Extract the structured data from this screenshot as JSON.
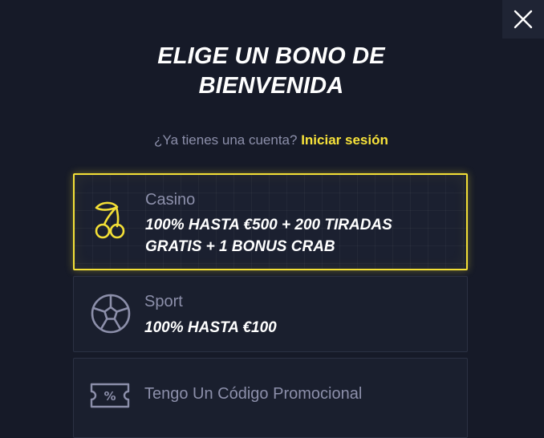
{
  "dialog": {
    "close_icon": "close-icon",
    "title_line1": "ELIGE UN BONO DE",
    "title_line2": "BIENVENIDA",
    "login_prompt": "¿Ya tienes una cuenta?",
    "login_link": "Iniciar sesión"
  },
  "bonuses": [
    {
      "icon": "cherries-icon",
      "label": "Casino",
      "desc_line1": "100% HASTA €500 + 200 TIRADAS",
      "desc_line2": "GRATIS + 1 BONUS CRAB",
      "selected": true
    },
    {
      "icon": "soccer-ball-icon",
      "label": "Sport",
      "desc_line1": "100% HASTA €100",
      "selected": false
    },
    {
      "icon": "promo-ticket-icon",
      "label": "Tengo Un Código Promocional",
      "selected": false
    }
  ],
  "colors": {
    "background": "#161a28",
    "card": "#1a1f2e",
    "accent": "#f3df36",
    "link": "#f8e33a",
    "muted_text": "#8c8faa"
  }
}
